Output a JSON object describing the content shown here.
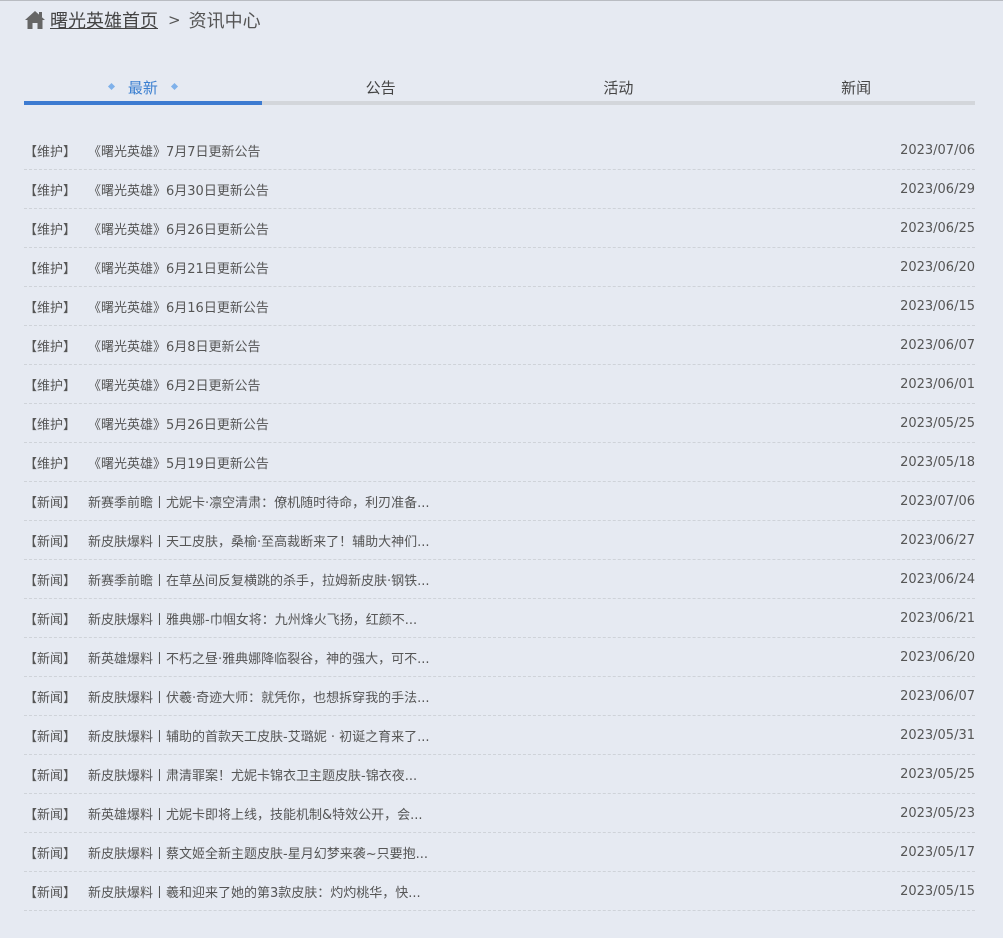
{
  "breadcrumb": {
    "home": "曙光英雄首页",
    "separator": ">",
    "current": "资讯中心"
  },
  "tabs": [
    {
      "label": "最新",
      "active": true
    },
    {
      "label": "公告",
      "active": false
    },
    {
      "label": "活动",
      "active": false
    },
    {
      "label": "新闻",
      "active": false
    }
  ],
  "colors": {
    "accent": "#3d7bd1",
    "background": "#e6eaf2"
  },
  "icons": {
    "home": "home-icon",
    "active_tab_marker": "diamond-icon"
  },
  "items": [
    {
      "tag": "【维护】",
      "title": "《曙光英雄》7月7日更新公告",
      "date": "2023/07/06"
    },
    {
      "tag": "【维护】",
      "title": "《曙光英雄》6月30日更新公告",
      "date": "2023/06/29"
    },
    {
      "tag": "【维护】",
      "title": "《曙光英雄》6月26日更新公告",
      "date": "2023/06/25"
    },
    {
      "tag": "【维护】",
      "title": "《曙光英雄》6月21日更新公告",
      "date": "2023/06/20"
    },
    {
      "tag": "【维护】",
      "title": "《曙光英雄》6月16日更新公告",
      "date": "2023/06/15"
    },
    {
      "tag": "【维护】",
      "title": "《曙光英雄》6月8日更新公告",
      "date": "2023/06/07"
    },
    {
      "tag": "【维护】",
      "title": "《曙光英雄》6月2日更新公告",
      "date": "2023/06/01"
    },
    {
      "tag": "【维护】",
      "title": "《曙光英雄》5月26日更新公告",
      "date": "2023/05/25"
    },
    {
      "tag": "【维护】",
      "title": "《曙光英雄》5月19日更新公告",
      "date": "2023/05/18"
    },
    {
      "tag": "【新闻】",
      "title": "新赛季前瞻丨尤妮卡·凛空清肃：僚机随时待命，利刃准备...",
      "date": "2023/07/06"
    },
    {
      "tag": "【新闻】",
      "title": "新皮肤爆料丨天工皮肤，桑榆·至高裁断来了！辅助大神们...",
      "date": "2023/06/27"
    },
    {
      "tag": "【新闻】",
      "title": "新赛季前瞻丨在草丛间反复横跳的杀手，拉姆新皮肤·钢铁...",
      "date": "2023/06/24"
    },
    {
      "tag": "【新闻】",
      "title": "新皮肤爆料丨雅典娜-巾帼女将：九州烽火飞扬，红颜不...",
      "date": "2023/06/21"
    },
    {
      "tag": "【新闻】",
      "title": "新英雄爆料丨不朽之昼·雅典娜降临裂谷，神的强大，可不...",
      "date": "2023/06/20"
    },
    {
      "tag": "【新闻】",
      "title": "新皮肤爆料丨伏羲·奇迹大师：就凭你，也想拆穿我的手法...",
      "date": "2023/06/07"
    },
    {
      "tag": "【新闻】",
      "title": "新皮肤爆料丨辅助的首款天工皮肤-艾璐妮 · 初诞之育来了...",
      "date": "2023/05/31"
    },
    {
      "tag": "【新闻】",
      "title": "新皮肤爆料丨肃清罪案！尤妮卡锦衣卫主题皮肤-锦衣夜...",
      "date": "2023/05/25"
    },
    {
      "tag": "【新闻】",
      "title": "新英雄爆料丨尤妮卡即将上线，技能机制&特效公开，会...",
      "date": "2023/05/23"
    },
    {
      "tag": "【新闻】",
      "title": "新皮肤爆料丨蔡文姬全新主题皮肤-星月幻梦来袭~只要抱...",
      "date": "2023/05/17"
    },
    {
      "tag": "【新闻】",
      "title": "新皮肤爆料丨羲和迎来了她的第3款皮肤：灼灼桃华，快...",
      "date": "2023/05/15"
    }
  ]
}
